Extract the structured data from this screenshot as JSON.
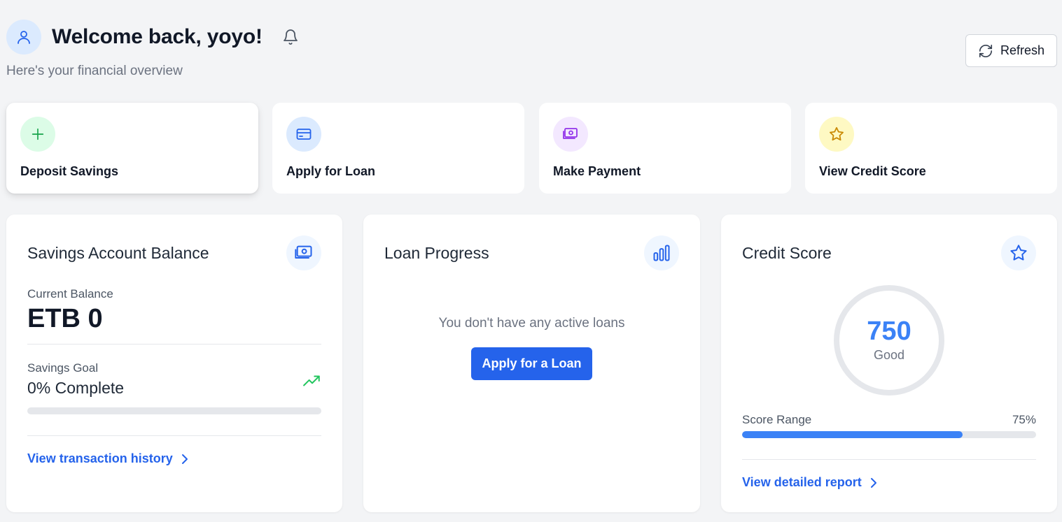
{
  "header": {
    "welcome": "Welcome back, yoyo!",
    "subtitle": "Here's your financial overview",
    "refresh_label": "Refresh"
  },
  "quick_actions": [
    {
      "label": "Deposit Savings",
      "icon": "plus-icon",
      "bg": "#dcfce7",
      "color": "#16a34a"
    },
    {
      "label": "Apply for Loan",
      "icon": "credit-card-icon",
      "bg": "#dbeafe",
      "color": "#2563eb"
    },
    {
      "label": "Make Payment",
      "icon": "banknote-icon",
      "bg": "#f3e8ff",
      "color": "#9333ea"
    },
    {
      "label": "View Credit Score",
      "icon": "star-icon",
      "bg": "#fef9c3",
      "color": "#ca8a04"
    }
  ],
  "savings": {
    "title": "Savings Account Balance",
    "current_balance_label": "Current Balance",
    "current_balance": "ETB 0",
    "goal_label": "Savings Goal",
    "goal_value": "0% Complete",
    "goal_progress": 0,
    "link": "View transaction history"
  },
  "loan": {
    "title": "Loan Progress",
    "empty_message": "You don't have any active loans",
    "apply_button": "Apply for a Loan"
  },
  "credit": {
    "title": "Credit Score",
    "score": "750",
    "rating": "Good",
    "range_label": "Score Range",
    "range_percent": "75%",
    "range_progress": 0.75,
    "link": "View detailed report"
  },
  "colors": {
    "accent": "#2563eb",
    "accent_light": "#3b82f6",
    "background": "#f3f4f6"
  }
}
